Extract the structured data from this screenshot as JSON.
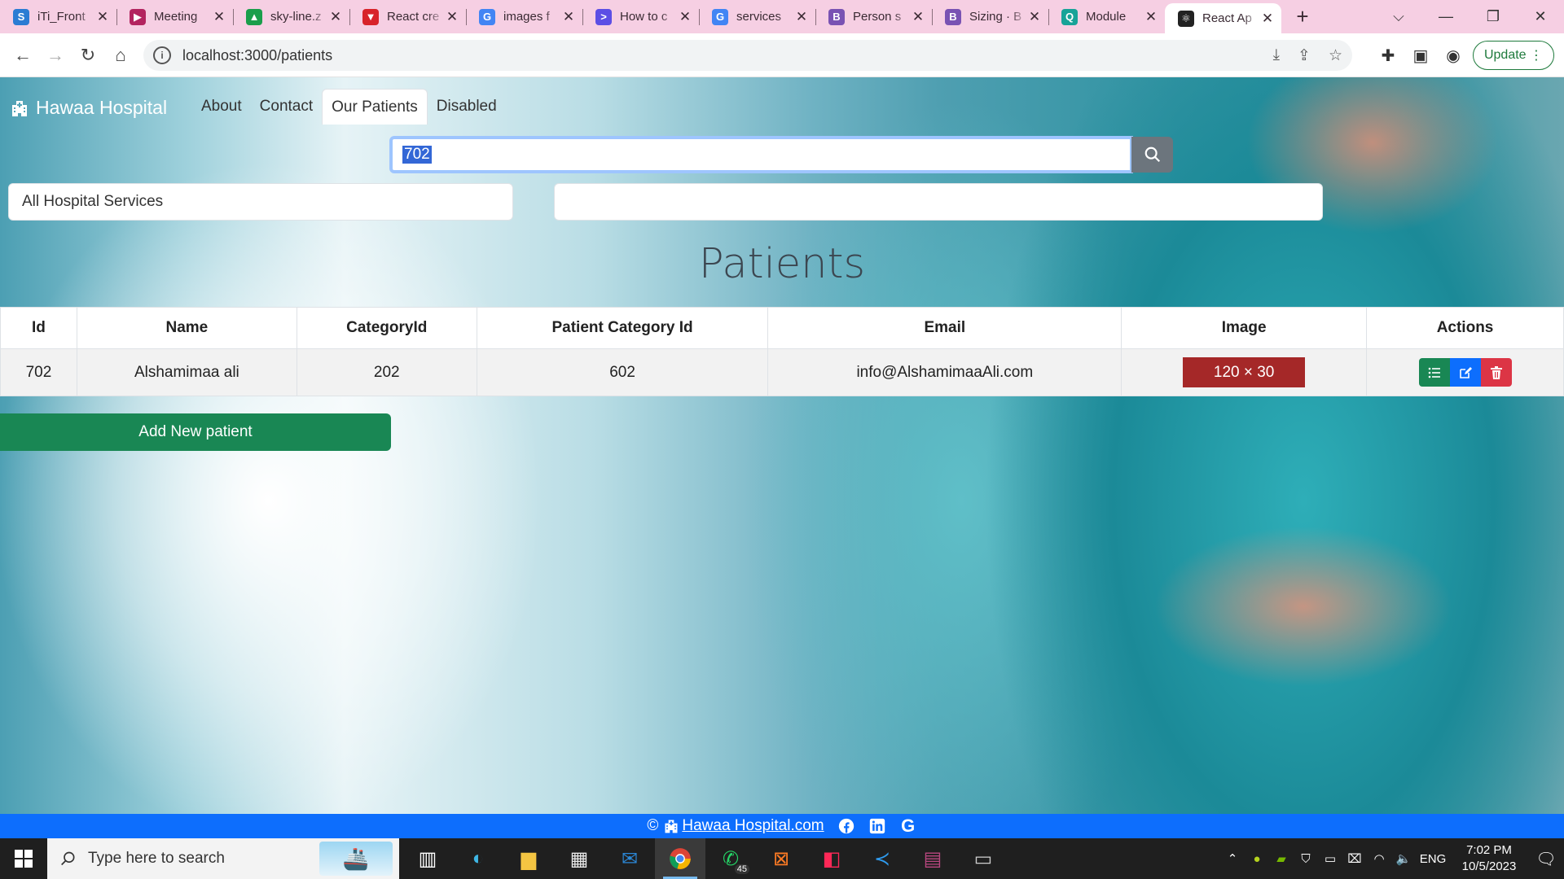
{
  "browser": {
    "tabs": [
      {
        "title": "iTi_Front",
        "favicon": "S",
        "color": "#2b7cd3"
      },
      {
        "title": "Meeting",
        "favicon": "▶",
        "color": "#b3245f"
      },
      {
        "title": "sky-line.z",
        "favicon": "▲",
        "color": "#1a9e4b"
      },
      {
        "title": "React cre",
        "favicon": "▼",
        "color": "#d8232a"
      },
      {
        "title": "images f",
        "favicon": "G",
        "color": "#4285f4"
      },
      {
        "title": "How to c",
        "favicon": ">",
        "color": "#5c4ee5"
      },
      {
        "title": "services",
        "favicon": "G",
        "color": "#4285f4"
      },
      {
        "title": "Person s",
        "favicon": "B",
        "color": "#7952b3"
      },
      {
        "title": "Sizing · B",
        "favicon": "B",
        "color": "#7952b3"
      },
      {
        "title": "Module",
        "favicon": "Q",
        "color": "#17a398"
      },
      {
        "title": "React Ap",
        "favicon": "⚛",
        "color": "#222222"
      }
    ],
    "url": "localhost:3000/patients",
    "update_label": "Update"
  },
  "app": {
    "brand": "Hawaa Hospital",
    "nav": [
      {
        "label": "About",
        "active": false
      },
      {
        "label": "Contact",
        "active": false
      },
      {
        "label": "Our Patients",
        "active": true
      },
      {
        "label": "Disabled",
        "active": false
      }
    ],
    "search_value": "702",
    "service_select": "All Hospital Services",
    "second_select": "",
    "heading": "Patients",
    "table": {
      "headers": [
        "Id",
        "Name",
        "CategoryId",
        "Patient Category Id",
        "Email",
        "Image",
        "Actions"
      ],
      "rows": [
        {
          "id": "702",
          "name": "Alshamimaa ali",
          "category_id": "202",
          "patient_category_id": "602",
          "email": "info@AlshamimaaAli.com",
          "image": "120 × 30"
        }
      ]
    },
    "add_button": "Add New patient",
    "footer": {
      "copyright": "©",
      "link": "Hawaa Hospital.com"
    }
  },
  "taskbar": {
    "search_placeholder": "Type here to search",
    "whatsapp_badge": "45",
    "language": "ENG",
    "time": "7:02 PM",
    "date": "10/5/2023"
  }
}
